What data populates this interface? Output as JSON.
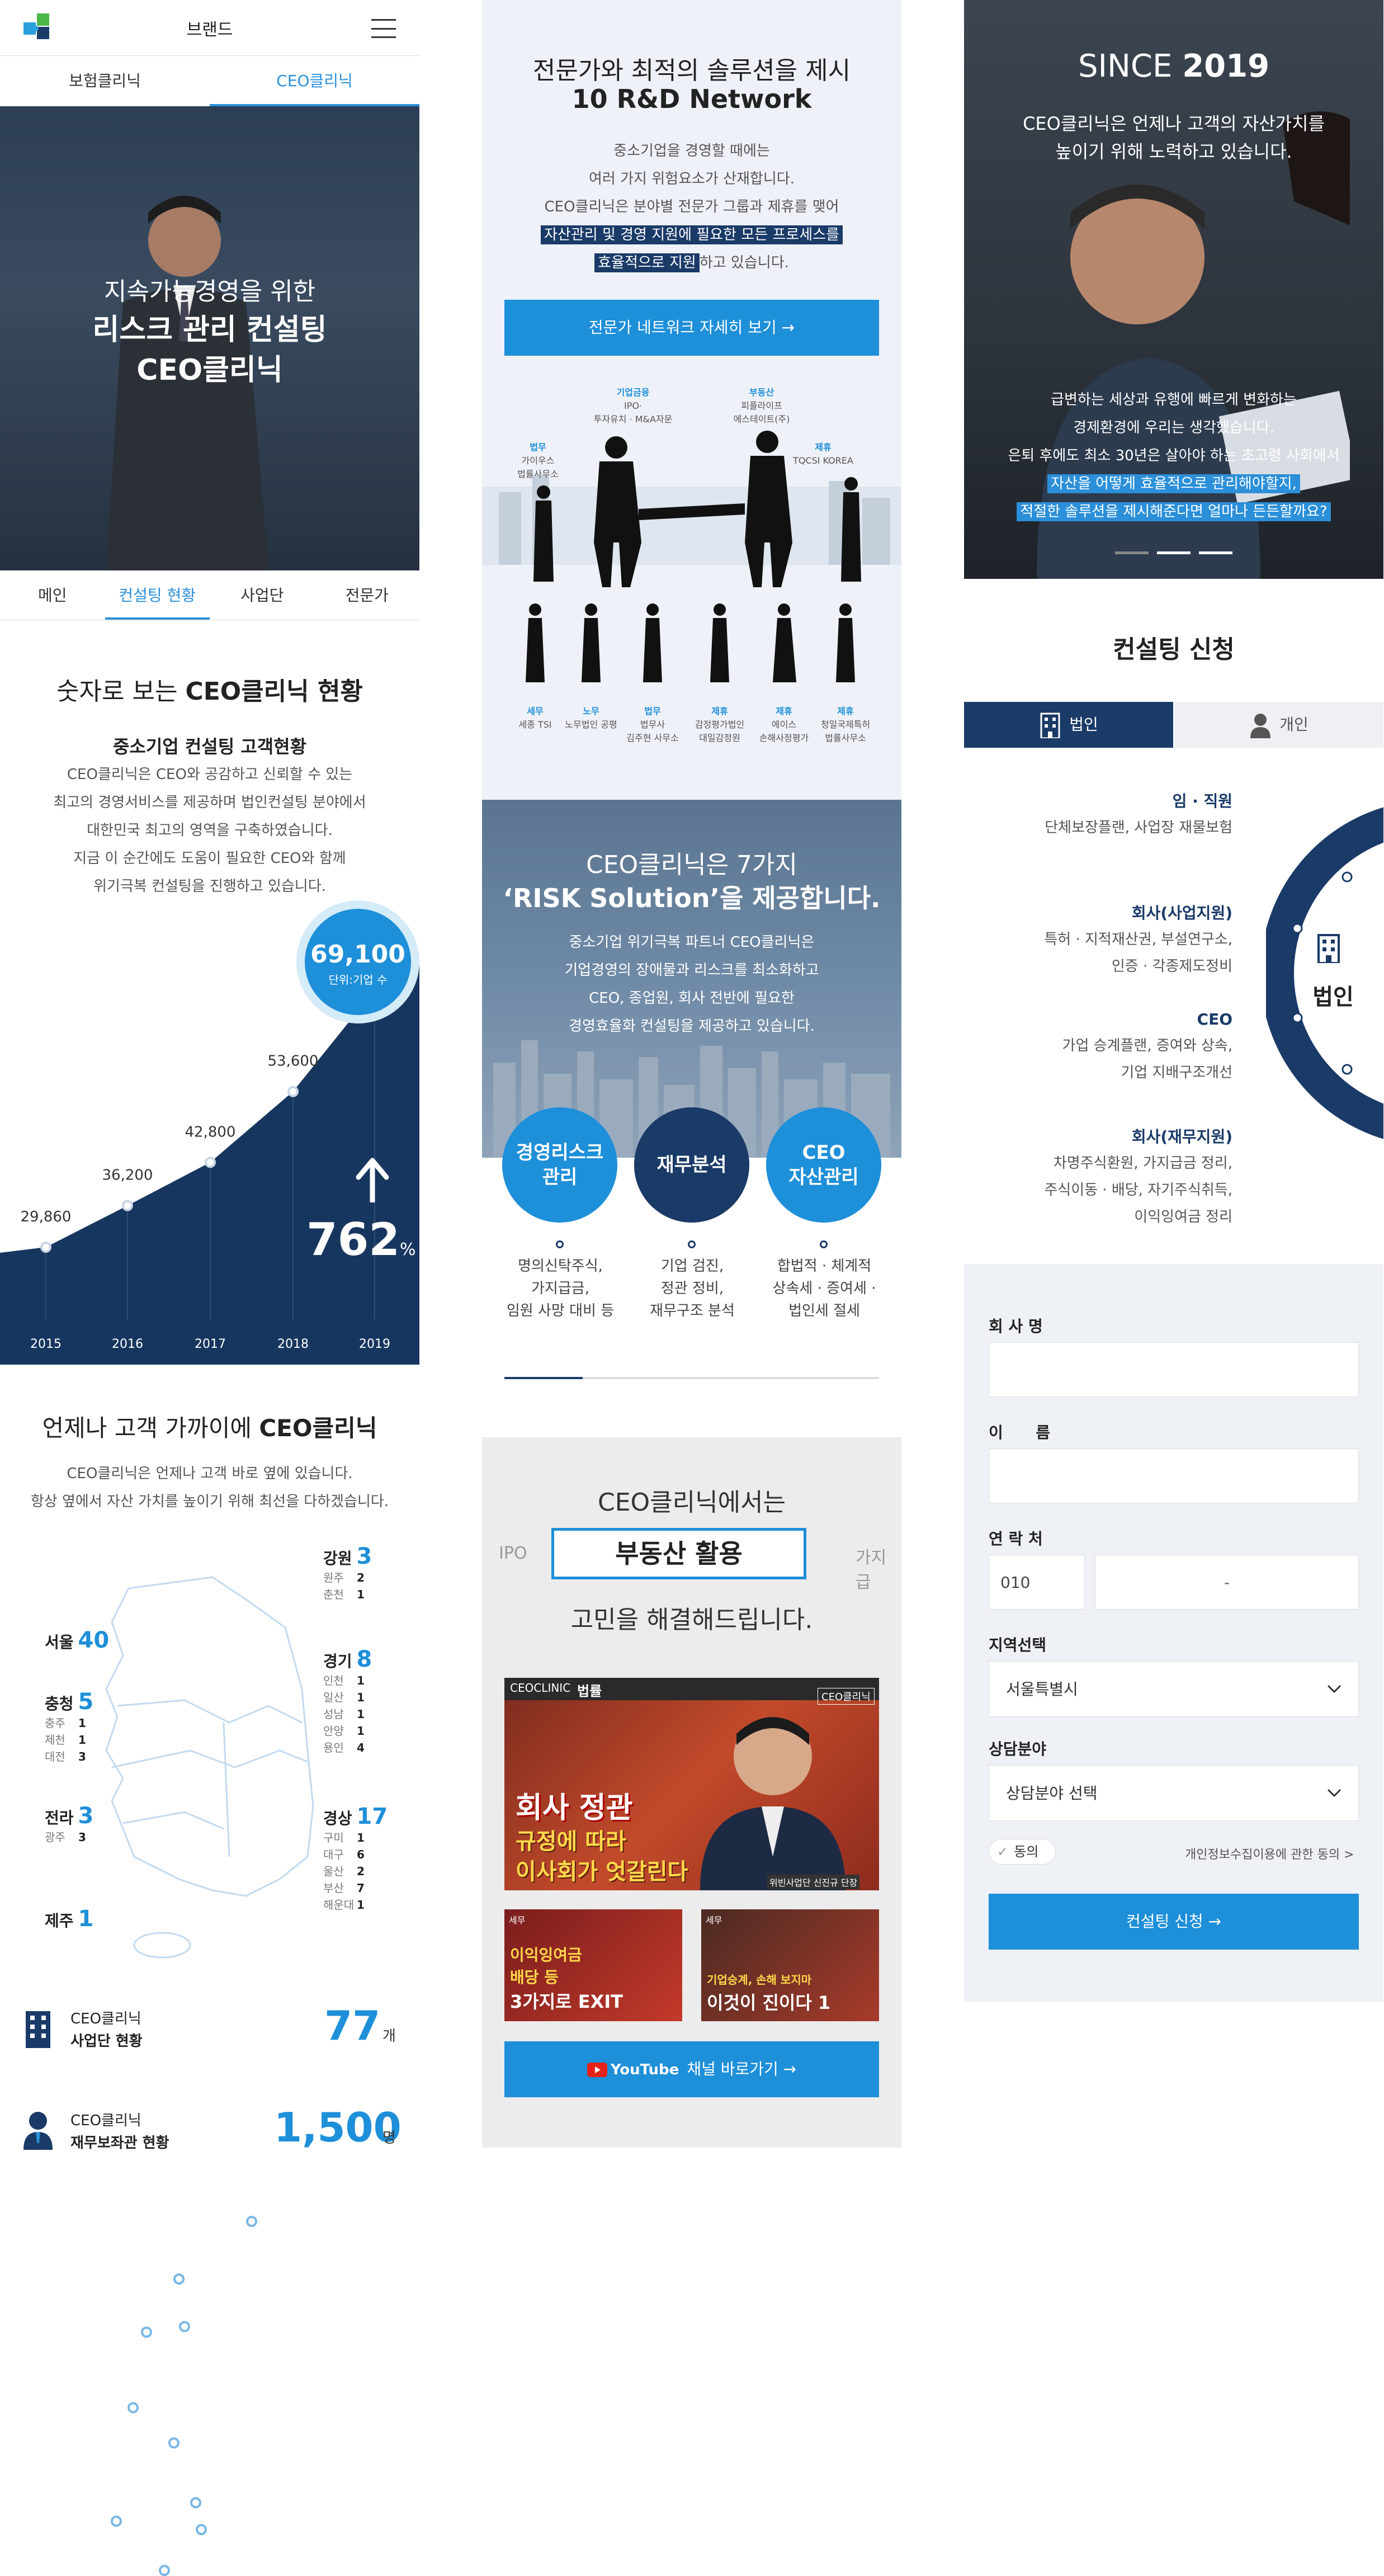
{
  "col1": {
    "header": {
      "brand": "브랜드"
    },
    "top_tabs": [
      "보험클리닉",
      "CEO클리닉"
    ],
    "hero": {
      "line1": "지속가능경영을 위한",
      "line2": "리스크 관리 컨설팅",
      "line3": "CEO클리닉"
    },
    "sub_tabs": [
      "메인",
      "컨설팅 현황",
      "사업단",
      "전문가"
    ],
    "stats": {
      "title_pre": "숫자로 보는 ",
      "title_bold": "CEO클리닉 현황",
      "subtitle": "중소기업 컨설팅 고객현황",
      "desc": [
        "CEO클리닉은 CEO와 공감하고 신뢰할 수 있는",
        "최고의 경영서비스를 제공하며 법인컨설팅 분야에서",
        "대한민국 최고의 영역을 구축하였습니다.",
        "지금 이 순간에도 도움이 필요한 CEO와 함께",
        "위기극복 컨설팅을 진행하고 있습니다."
      ],
      "bubble_value": "69,100",
      "bubble_unit": "단위:기업 수",
      "growth": "762",
      "growth_unit": "%"
    },
    "chart_data": {
      "type": "area",
      "x": [
        "2015",
        "2016",
        "2017",
        "2018",
        "2019"
      ],
      "values": [
        29860,
        36200,
        42800,
        53600,
        69100
      ],
      "labels": [
        "29,860",
        "36,200",
        "42,800",
        "53,600",
        "69,100"
      ]
    },
    "near": {
      "title_pre": "언제나 고객 가까이에 ",
      "title_bold": "CEO클리닉",
      "desc": [
        "CEO클리닉은 언제나 고객 바로 옆에 있습니다.",
        "항상 옆에서 자산 가치를 높이기 위해 최선을 다하겠습니다."
      ]
    },
    "regions": [
      {
        "name": "강원",
        "count": "3",
        "subs": [
          [
            "원주",
            "2"
          ],
          [
            "춘천",
            "1"
          ]
        ]
      },
      {
        "name": "서울",
        "count": "40",
        "subs": []
      },
      {
        "name": "경기",
        "count": "8",
        "subs": [
          [
            "인천",
            "1"
          ],
          [
            "일산",
            "1"
          ],
          [
            "성남",
            "1"
          ],
          [
            "안양",
            "1"
          ],
          [
            "용인",
            "4"
          ]
        ]
      },
      {
        "name": "충청",
        "count": "5",
        "subs": [
          [
            "충주",
            "1"
          ],
          [
            "제천",
            "1"
          ],
          [
            "대전",
            "3"
          ]
        ]
      },
      {
        "name": "전라",
        "count": "3",
        "subs": [
          [
            "광주",
            "3"
          ]
        ]
      },
      {
        "name": "경상",
        "count": "17",
        "subs": [
          [
            "구미",
            "1"
          ],
          [
            "대구",
            "6"
          ],
          [
            "울산",
            "2"
          ],
          [
            "부산",
            "7"
          ],
          [
            "해운대",
            "1"
          ]
        ]
      },
      {
        "name": "제주",
        "count": "1",
        "subs": []
      }
    ],
    "summary": [
      {
        "line1": "CEO클리닉",
        "line2": "사업단 현황",
        "value": "77",
        "unit": "개"
      },
      {
        "line1": "CEO클리닉",
        "line2": "재무보좌관 현황",
        "value": "1,500",
        "unit": "명"
      }
    ]
  },
  "col2": {
    "net": {
      "title1": "전문가와 최적의 솔루션을 제시",
      "title2": "10 R&D Network",
      "desc": [
        "중소기업을 경영할 때에는",
        "여러 가지 위험요소가 산재합니다.",
        "CEO클리닉은 분야별 전문가 그룹과 제휴를 맺어"
      ],
      "hl1": "자산관리 및 경영 지원에 필요한 모든 프로세스를",
      "hl2": "효율적으로 지원",
      "hl2_tail": "하고 있습니다.",
      "button": "전문가 네트워크 자세히 보기 →"
    },
    "partners_top": [
      {
        "a": "기업금융",
        "b": "IPO·",
        "c": "투자유치 · M&A자문"
      },
      {
        "a": "부동산",
        "b": "피플라이프",
        "c": "에스테이트(주)"
      },
      {
        "a": "법무",
        "b": "가이우스",
        "c": "법률사무소"
      },
      {
        "a": "제휴",
        "b": "TQCSI KOREA",
        "c": ""
      }
    ],
    "partners_bottom": [
      {
        "a": "세무",
        "b": "세종 TSI",
        "c": ""
      },
      {
        "a": "노무",
        "b": "노무법인 공평",
        "c": ""
      },
      {
        "a": "법무",
        "b": "법무사",
        "c": "김주현 사무소"
      },
      {
        "a": "제휴",
        "b": "감정평가법인",
        "c": "대일감정원"
      },
      {
        "a": "제휴",
        "b": "에이스",
        "c": "손해사정평가"
      },
      {
        "a": "제휴",
        "b": "청일국제특허",
        "c": "법률사무소"
      }
    ],
    "risk": {
      "title1": "CEO클리닉은 7가지",
      "title2": "‘RISK Solution’을 제공합니다.",
      "desc": [
        "중소기업 위기극복 파트너 CEO클리닉은",
        "기업경영의 장애물과 리스크를 최소화하고",
        "CEO, 종업원, 회사 전반에 필요한",
        "경영효율화 컨설팅을 제공하고 있습니다."
      ],
      "circles": [
        {
          "label1": "경영리스크",
          "label2": "관리",
          "d1": "명의신탁주식,",
          "d2": "가지급금,",
          "d3": "임원 사망 대비 등"
        },
        {
          "label1": "재무분석",
          "label2": "",
          "d1": "기업 검진,",
          "d2": "정관 정비,",
          "d3": "재무구조 분석"
        },
        {
          "label1": "CEO",
          "label2": "자산관리",
          "d1": "합법적 · 체계적",
          "d2": "상속세 · 증여세 ·",
          "d3": "법인세 절세"
        }
      ]
    },
    "solve": {
      "line1": "CEO클리닉에서는",
      "left": "IPO",
      "center": "부동산 활용",
      "right": "가지급",
      "line2": "고민을 해결해드립니다."
    },
    "video": {
      "tag": "CEOCLINIC",
      "tag2": "법률",
      "badge": "CEO클리닉",
      "t1": "회사 정관",
      "t2": "규정에 따라",
      "t3": "이사회가 엇갈린다",
      "caption": "위빈사업단 신진규 단장",
      "thumb1_tag": "세무",
      "thumb1_t1": "이익잉여금",
      "thumb1_t2": "배당 등",
      "thumb1_t3": "3가지로 EXIT",
      "thumb2_tag": "세무",
      "thumb2_t1": "기업승계, 손해 보지마",
      "thumb2_t2": "이것이 진이다 1"
    },
    "yt_button": {
      "brand": "YouTube",
      "label": "채널 바로가기 →"
    }
  },
  "col3": {
    "since": {
      "title_pre": "SINCE ",
      "year": "2019",
      "desc1": "CEO클리닉은 언제나 고객의 자산가치를",
      "desc2": "높이기 위해 노력하고 있습니다.",
      "body": [
        "급변하는 세상과 유행에 빠르게 변화하는",
        "경제환경에 우리는 생각했습니다.",
        "은퇴 후에도 최소 30년은 살아야 하는 초고령 사회에서"
      ],
      "hl1": "자산을 어떻게 효율적으로 관리해야할지,",
      "hl2": "적절한 솔루션을 제시해준다면 얼마나 든든할까요?"
    },
    "apply": {
      "title": "컨설팅 신청",
      "tab_corp": "법인",
      "tab_personal": "개인",
      "center_label": "법인",
      "items": [
        {
          "title": "임 · 직원",
          "lines": [
            "단체보장플랜, 사업장 재물보험"
          ]
        },
        {
          "title": "회사(사업지원)",
          "lines": [
            "특허 · 지적재산권, 부설연구소,",
            "인증 · 각종제도정비"
          ]
        },
        {
          "title": "CEO",
          "lines": [
            "가업 승계플랜, 증여와 상속,",
            "기업 지배구조개선"
          ]
        },
        {
          "title": "회사(재무지원)",
          "lines": [
            "차명주식환원, 가지급금 정리,",
            "주식이동 · 배당, 자기주식취득,",
            "이익잉여금 정리"
          ]
        }
      ]
    },
    "form": {
      "company_label": "회 사 명",
      "name_label": "이      름",
      "phone_label": "연 락 처",
      "phone_prefix": "010",
      "phone_sep": "-",
      "region_label": "지역선택",
      "region_value": "서울특별시",
      "field_label": "상담분야",
      "field_value": "상담분야 선택",
      "agree": "동의",
      "privacy": "개인정보수집이용에 관한 동의 >",
      "submit": "컨설팅 신청 →"
    }
  },
  "colors": {
    "navy": "#1a3a68",
    "blue": "#1e8fd9",
    "light": "#eef2f8"
  }
}
